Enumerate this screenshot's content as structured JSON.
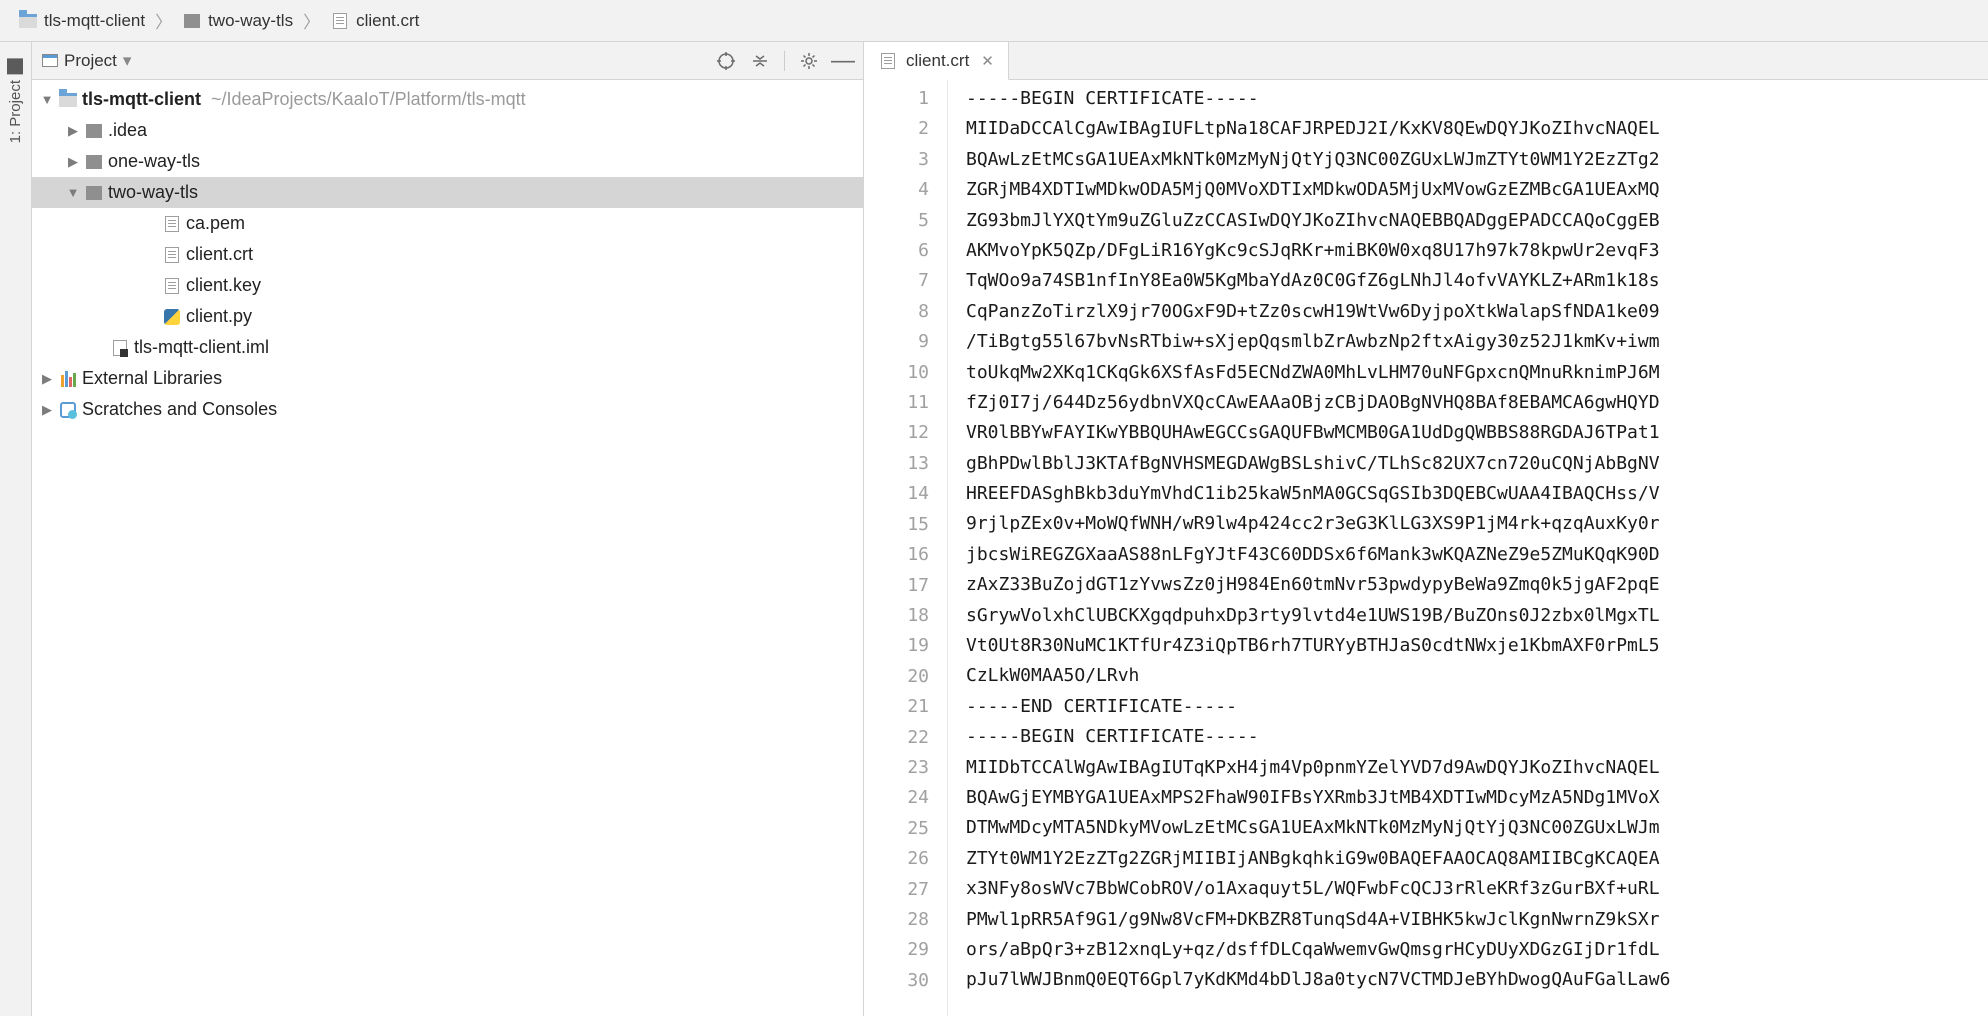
{
  "breadcrumb": {
    "items": [
      {
        "label": "tls-mqtt-client",
        "iconType": "app-folder"
      },
      {
        "label": "two-way-tls",
        "iconType": "folder"
      },
      {
        "label": "client.crt",
        "iconType": "file"
      }
    ],
    "separator": "〉"
  },
  "sideStrip": {
    "tab": "1: Project"
  },
  "projectPanel": {
    "title": "Project",
    "tree": [
      {
        "indent": 0,
        "expand": "down",
        "icon": "app-folder",
        "label": "tls-mqtt-client",
        "bold": true,
        "path": "~/IdeaProjects/KaaIoT/Platform/tls-mqtt"
      },
      {
        "indent": 1,
        "expand": "right",
        "icon": "folder",
        "label": ".idea"
      },
      {
        "indent": 1,
        "expand": "right",
        "icon": "folder",
        "label": "one-way-tls"
      },
      {
        "indent": 1,
        "expand": "down",
        "icon": "folder",
        "label": "two-way-tls",
        "selected": true
      },
      {
        "indent": 3,
        "expand": "",
        "icon": "file",
        "label": "ca.pem"
      },
      {
        "indent": 3,
        "expand": "",
        "icon": "file",
        "label": "client.crt"
      },
      {
        "indent": 3,
        "expand": "",
        "icon": "file",
        "label": "client.key"
      },
      {
        "indent": 3,
        "expand": "",
        "icon": "py",
        "label": "client.py"
      },
      {
        "indent": 2,
        "expand": "",
        "icon": "iml",
        "label": "tls-mqtt-client.iml"
      },
      {
        "indent": 0,
        "expand": "right",
        "icon": "lib",
        "label": "External Libraries"
      },
      {
        "indent": 0,
        "expand": "right",
        "icon": "scratch",
        "label": "Scratches and Consoles"
      }
    ]
  },
  "editor": {
    "tab": {
      "label": "client.crt"
    },
    "lines": [
      "-----BEGIN CERTIFICATE-----",
      "MIIDaDCCAlCgAwIBAgIUFLtpNa18CAFJRPEDJ2I/KxKV8QEwDQYJKoZIhvcNAQEL",
      "BQAwLzEtMCsGA1UEAxMkNTk0MzMyNjQtYjQ3NC00ZGUxLWJmZTYt0WM1Y2EzZTg2",
      "ZGRjMB4XDTIwMDkwODA5MjQ0MVoXDTIxMDkwODA5MjUxMVowGzEZMBcGA1UEAxMQ",
      "ZG93bmJlYXQtYm9uZGluZzCCASIwDQYJKoZIhvcNAQEBBQADggEPADCCAQoCggEB",
      "AKMvoYpK5QZp/DFgLiR16YgKc9cSJqRKr+miBK0W0xq8U17h97k78kpwUr2evqF3",
      "TqWOo9a74SB1nfInY8Ea0W5KgMbaYdAz0C0GfZ6gLNhJl4ofvVAYKLZ+ARm1k18s",
      "CqPanzZoTirzlX9jr70OGxF9D+tZz0scwH19WtVw6DyjpoXtkWalapSfNDA1ke09",
      "/TiBgtg55l67bvNsRTbiw+sXjepQqsmlbZrAwbzNp2ftxAigy30z52J1kmKv+iwm",
      "toUkqMw2XKq1CKqGk6XSfAsFd5ECNdZWA0MhLvLHM70uNFGpxcnQMnuRknimPJ6M",
      "fZj0I7j/644Dz56ydbnVXQcCAwEAAaOBjzCBjDAOBgNVHQ8BAf8EBAMCA6gwHQYD",
      "VR0lBBYwFAYIKwYBBQUHAwEGCCsGAQUFBwMCMB0GA1UdDgQWBBS88RGDAJ6TPat1",
      "gBhPDwlBblJ3KTAfBgNVHSMEGDAWgBSLshivC/TLhSc82UX7cn720uCQNjAbBgNV",
      "HREEFDASghBkb3duYmVhdC1ib25kaW5nMA0GCSqGSIb3DQEBCwUAA4IBAQCHss/V",
      "9rjlpZEx0v+MoWQfWNH/wR9lw4p424cc2r3eG3KlLG3XS9P1jM4rk+qzqAuxKy0r",
      "jbcsWiREGZGXaaAS88nLFgYJtF43C60DDSx6f6Mank3wKQAZNeZ9e5ZMuKQqK90D",
      "zAxZ33BuZojdGT1zYvwsZz0jH984En60tmNvr53pwdypyBeWa9Zmq0k5jgAF2pqE",
      "sGrywVolxhClUBCKXgqdpuhxDp3rty9lvtd4e1UWS19B/BuZOns0J2zbx0lMgxTL",
      "Vt0Ut8R30NuMC1KTfUr4Z3iQpTB6rh7TURYyBTHJaS0cdtNWxje1KbmAXF0rPmL5",
      "CzLkW0MAA5O/LRvh",
      "-----END CERTIFICATE-----",
      "-----BEGIN CERTIFICATE-----",
      "MIIDbTCCAlWgAwIBAgIUTqKPxH4jm4Vp0pnmYZelYVD7d9AwDQYJKoZIhvcNAQEL",
      "BQAwGjEYMBYGA1UEAxMPS2FhaW90IFBsYXRmb3JtMB4XDTIwMDcyMzA5NDg1MVoX",
      "DTMwMDcyMTA5NDkyMVowLzEtMCsGA1UEAxMkNTk0MzMyNjQtYjQ3NC00ZGUxLWJm",
      "ZTYt0WM1Y2EzZTg2ZGRjMIIBIjANBgkqhkiG9w0BAQEFAAOCAQ8AMIIBCgKCAQEA",
      "x3NFy8osWVc7BbWCobROV/o1Axaquyt5L/WQFwbFcQCJ3rRleKRf3zGurBXf+uRL",
      "PMwl1pRR5Af9G1/g9Nw8VcFM+DKBZR8TunqSd4A+VIBHK5kwJclKgnNwrnZ9kSXr",
      "ors/aBpQr3+zB12xnqLy+qz/dsffDLCqaWwemvGwQmsgrHCyDUyXDGzGIjDr1fdL",
      "pJu7lWWJBnmQ0EQT6Gpl7yKdKMd4bDlJ8a0tycN7VCTMDJeBYhDwogQAuFGalLaw6"
    ]
  }
}
